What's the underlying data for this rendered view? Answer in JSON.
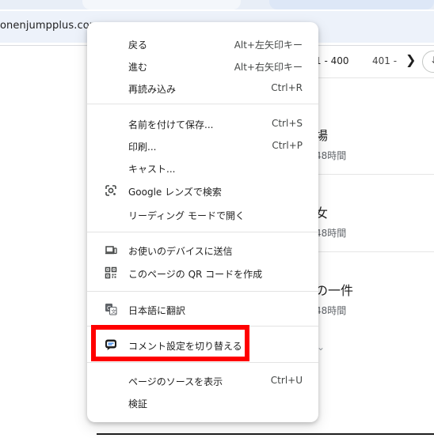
{
  "browser": {
    "url_text": "onenjumpplus.com"
  },
  "page": {
    "pagination": {
      "range_current": "1 - 400",
      "range_next": "401 -",
      "next_symbol": "❯",
      "download_symbol": "↓"
    },
    "entries": [
      {
        "title": "場",
        "meta": "48時間"
      },
      {
        "title": "女",
        "meta": "48時間"
      },
      {
        "title": "の一件",
        "meta": "48時間"
      }
    ],
    "expand_symbol": "⌄"
  },
  "context_menu": {
    "items": [
      {
        "id": "back",
        "label": "戻る",
        "shortcut": "Alt+左矢印キー",
        "icon": ""
      },
      {
        "id": "forward",
        "label": "進む",
        "shortcut": "Alt+右矢印キー",
        "icon": ""
      },
      {
        "id": "reload",
        "label": "再読み込み",
        "shortcut": "Ctrl+R",
        "icon": ""
      },
      {
        "id": "save-as",
        "label": "名前を付けて保存...",
        "shortcut": "Ctrl+S",
        "icon": ""
      },
      {
        "id": "print",
        "label": "印刷...",
        "shortcut": "Ctrl+P",
        "icon": ""
      },
      {
        "id": "cast",
        "label": "キャスト...",
        "shortcut": "",
        "icon": ""
      },
      {
        "id": "google-lens",
        "label": "Google レンズで検索",
        "shortcut": "",
        "icon": "google-lens-icon"
      },
      {
        "id": "reading-mode",
        "label": "リーディング モードで開く",
        "shortcut": "",
        "icon": ""
      },
      {
        "id": "send-to-devices",
        "label": "お使いのデバイスに送信",
        "shortcut": "",
        "icon": "devices-icon"
      },
      {
        "id": "qr-code",
        "label": "このページの QR コードを作成",
        "shortcut": "",
        "icon": "qr-code-icon"
      },
      {
        "id": "translate",
        "label": "日本語に翻訳",
        "shortcut": "",
        "icon": "translate-icon"
      },
      {
        "id": "toggle-comments",
        "label": "コメント設定を切り替える",
        "shortcut": "",
        "icon": "comment-extension-icon"
      },
      {
        "id": "view-source",
        "label": "ページのソースを表示",
        "shortcut": "Ctrl+U",
        "icon": ""
      },
      {
        "id": "inspect",
        "label": "検証",
        "shortcut": "",
        "icon": ""
      }
    ]
  },
  "annotation": {
    "highlight_color": "#ff0000",
    "highlighted_item": "toggle-comments"
  }
}
